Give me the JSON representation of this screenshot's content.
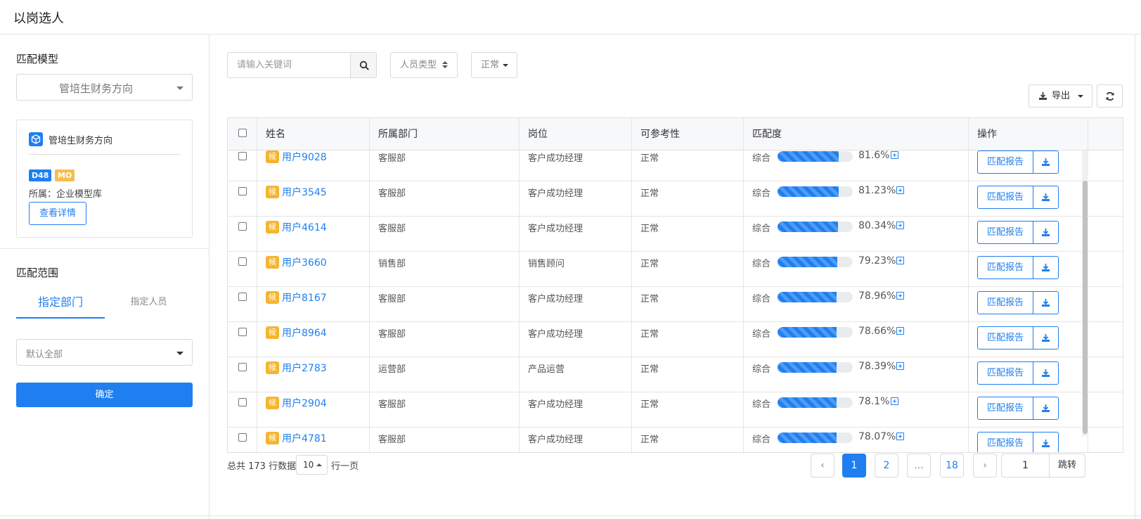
{
  "header": {
    "title": "以岗选人"
  },
  "sidebar": {
    "model_section_title": "匹配模型",
    "model_select_value": "管培生财务方向",
    "model_card": {
      "name": "管培生财务方向",
      "badge_1": "D48",
      "badge_2": "MO",
      "owner": "所属：企业模型库",
      "detail_button": "查看详情"
    },
    "scope_section_title": "匹配范围",
    "tabs": [
      {
        "label": "指定部门",
        "active": true
      },
      {
        "label": "指定人员",
        "active": false
      }
    ],
    "dept_select_value": "默认全部",
    "confirm_button": "确定"
  },
  "toolbar": {
    "search_placeholder": "请输入关键词",
    "type_filter": "人员类型",
    "status_filter": "正常",
    "export_button": "导出"
  },
  "table": {
    "columns": [
      "姓名",
      "所属部门",
      "岗位",
      "可参考性",
      "匹配度",
      "操作"
    ],
    "candidate_badge": "候",
    "match_label": "综合",
    "report_button": "匹配报告",
    "rows": [
      {
        "name": "用户9028",
        "dept": "客服部",
        "position": "客户成功经理",
        "ref": "正常",
        "pct_text": "81.6%",
        "pct": 81.6
      },
      {
        "name": "用户3545",
        "dept": "客服部",
        "position": "客户成功经理",
        "ref": "正常",
        "pct_text": "81.23%",
        "pct": 81.23
      },
      {
        "name": "用户4614",
        "dept": "客服部",
        "position": "客户成功经理",
        "ref": "正常",
        "pct_text": "80.34%",
        "pct": 80.34
      },
      {
        "name": "用户3660",
        "dept": "销售部",
        "position": "销售顾问",
        "ref": "正常",
        "pct_text": "79.23%",
        "pct": 79.23
      },
      {
        "name": "用户8167",
        "dept": "客服部",
        "position": "客户成功经理",
        "ref": "正常",
        "pct_text": "78.96%",
        "pct": 78.96
      },
      {
        "name": "用户8964",
        "dept": "客服部",
        "position": "客户成功经理",
        "ref": "正常",
        "pct_text": "78.66%",
        "pct": 78.66
      },
      {
        "name": "用户2783",
        "dept": "运营部",
        "position": "产品运营",
        "ref": "正常",
        "pct_text": "78.39%",
        "pct": 78.39
      },
      {
        "name": "用户2904",
        "dept": "客服部",
        "position": "客户成功经理",
        "ref": "正常",
        "pct_text": "78.1%",
        "pct": 78.1
      },
      {
        "name": "用户4781",
        "dept": "客服部",
        "position": "客户成功经理",
        "ref": "正常",
        "pct_text": "78.07%",
        "pct": 78.07
      }
    ]
  },
  "pagination": {
    "total_text": "总共 173 行数据",
    "page_size": "10",
    "per_page_text": "行一页",
    "prev": "‹",
    "pages": [
      "1",
      "2",
      "...",
      "18"
    ],
    "next": "›",
    "jump_value": "1",
    "jump_button": "跳转"
  },
  "colors": {
    "primary": "#1f7ff0",
    "candidate_badge": "#f6b52e",
    "mo_badge": "#f6be4f"
  }
}
